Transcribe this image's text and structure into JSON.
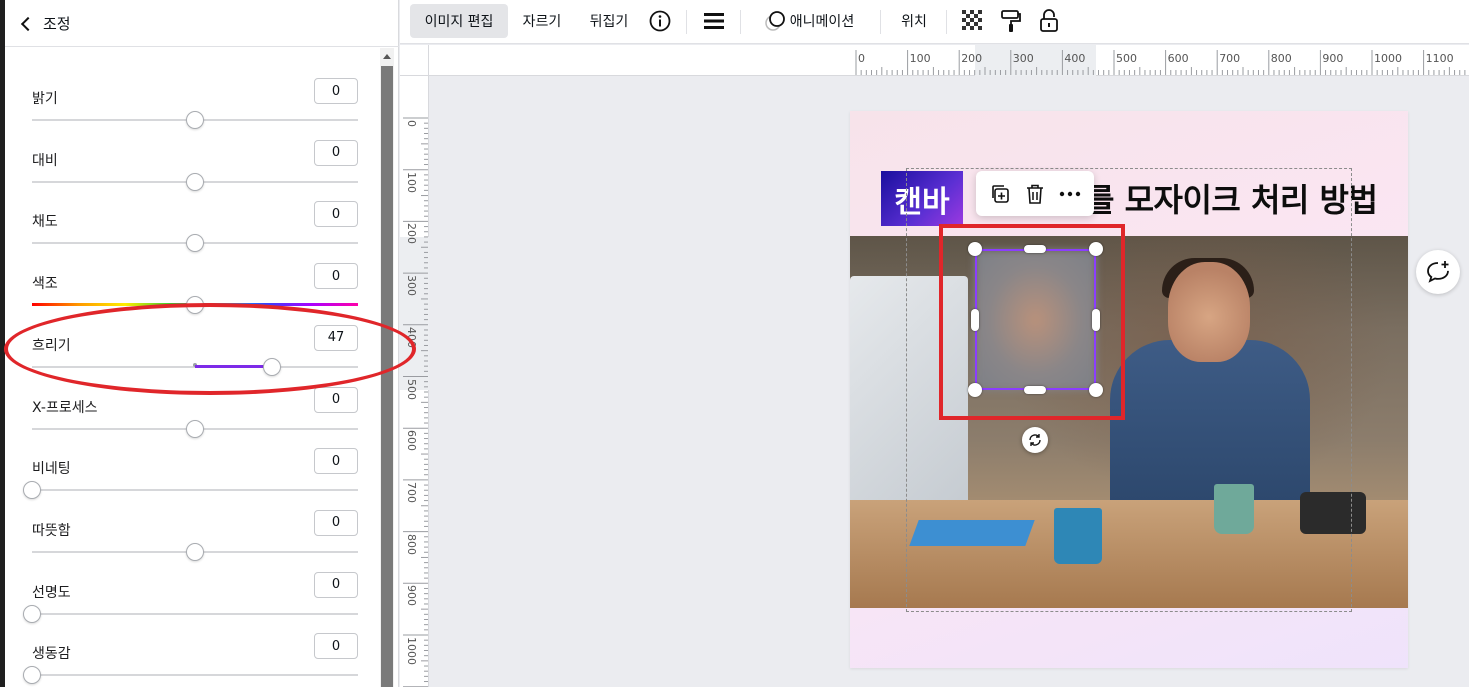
{
  "panel": {
    "back_label": "조정",
    "adjustments": [
      {
        "label": "밝기",
        "value": "0",
        "type": "center"
      },
      {
        "label": "대비",
        "value": "0",
        "type": "center"
      },
      {
        "label": "채도",
        "value": "0",
        "type": "center"
      },
      {
        "label": "색조",
        "value": "0",
        "type": "hue"
      },
      {
        "label": "흐리기",
        "value": "47",
        "type": "fill"
      },
      {
        "label": "X-프로세스",
        "value": "0",
        "type": "center"
      },
      {
        "label": "비네팅",
        "value": "0",
        "type": "left"
      },
      {
        "label": "따뜻함",
        "value": "0",
        "type": "center"
      },
      {
        "label": "선명도",
        "value": "0",
        "type": "left"
      },
      {
        "label": "생동감",
        "value": "0",
        "type": "left"
      }
    ]
  },
  "toolbar": {
    "edit_image": "이미지 편집",
    "crop": "자르기",
    "flip": "뒤집기",
    "info_icon": "info-icon",
    "menu_icon": "hamburger-icon",
    "animate": "애니메이션",
    "position": "위치"
  },
  "ruler": {
    "top_labels": [
      "0",
      "100",
      "200",
      "300",
      "400",
      "500",
      "600",
      "700",
      "800",
      "900",
      "1000",
      "1100"
    ],
    "left_labels": [
      "0",
      "100",
      "200",
      "300",
      "400",
      "500",
      "600",
      "700",
      "800",
      "900",
      "1000"
    ]
  },
  "canvas": {
    "badge_text": "캔바",
    "headline": "를 모자이크 처리 방법"
  },
  "colors": {
    "accent": "#8b3dff",
    "annotation_red": "#e0262a"
  }
}
